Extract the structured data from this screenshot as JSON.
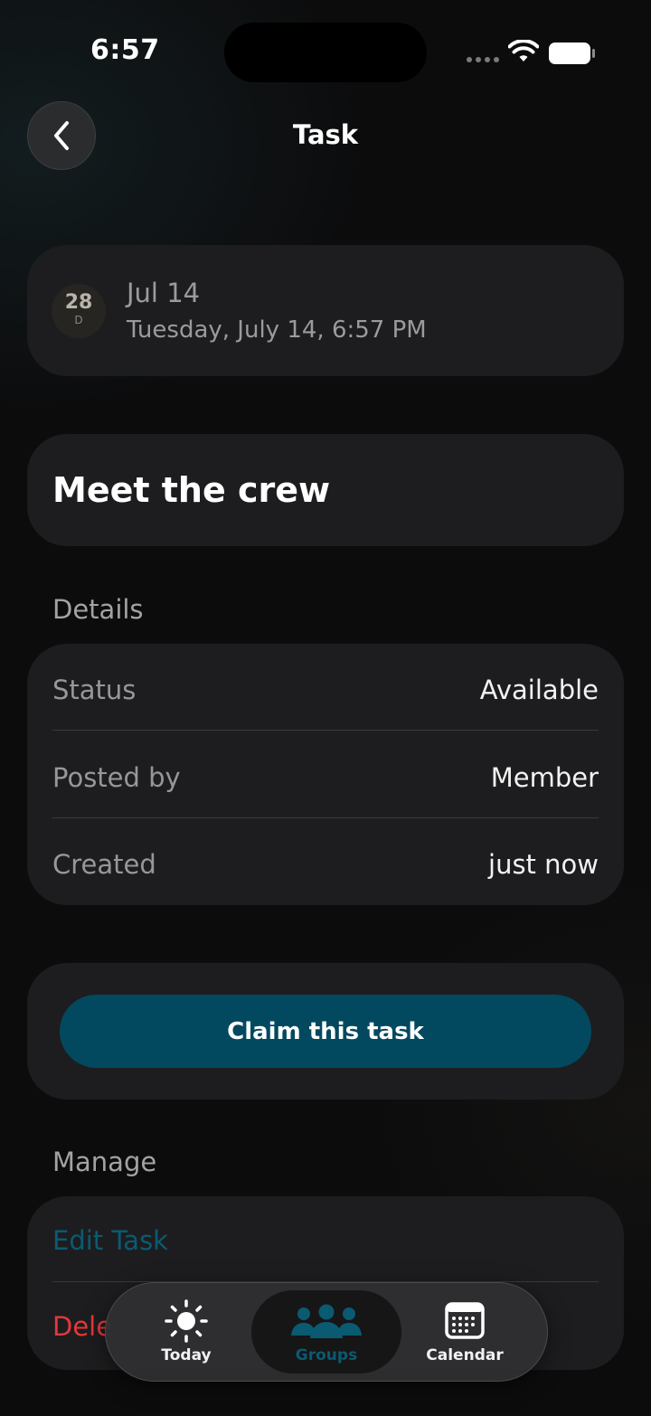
{
  "status_bar": {
    "time": "6:57"
  },
  "header": {
    "title": "Task",
    "back_icon": "chevron-left-icon"
  },
  "date_card": {
    "badge_number": "28",
    "badge_unit": "D",
    "short_date": "Jul 14",
    "full_date": "Tuesday, July 14, 6:57 PM"
  },
  "task": {
    "title": "Meet the crew"
  },
  "details": {
    "section_label": "Details",
    "rows": [
      {
        "label": "Status",
        "value": "Available"
      },
      {
        "label": "Posted by",
        "value": "Member"
      },
      {
        "label": "Created",
        "value": "just now"
      }
    ]
  },
  "claim": {
    "button_label": "Claim this task"
  },
  "manage": {
    "section_label": "Manage",
    "edit_label": "Edit Task",
    "delete_label": "Dele"
  },
  "tabbar": {
    "tabs": [
      {
        "label": "Today",
        "icon": "sun-icon"
      },
      {
        "label": "Groups",
        "icon": "groups-icon",
        "selected": true
      },
      {
        "label": "Calendar",
        "icon": "calendar-icon"
      }
    ]
  },
  "colors": {
    "accent": "#02495f",
    "accent_text": "#0b5a72",
    "destructive": "#e5383b",
    "card": "#1d1d1f"
  }
}
